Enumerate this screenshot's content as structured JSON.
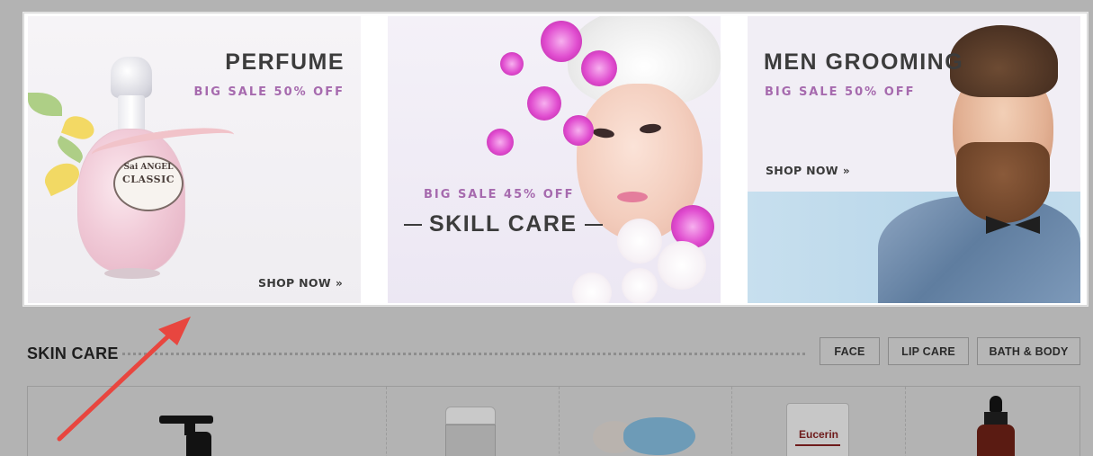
{
  "banners": [
    {
      "title": "PERFUME",
      "sale": "BIG SALE 50% OFF",
      "cta": "SHOP NOW",
      "bottle_brand": "Sai ANGEL",
      "bottle_label": "CLASSIC"
    },
    {
      "title": "SKILL CARE",
      "sale": "BIG SALE 45% OFF"
    },
    {
      "title": "MEN GROOMING",
      "sale": "BIG SALE 50% OFF",
      "cta": "SHOP NOW"
    }
  ],
  "section": {
    "title": "SKIN CARE",
    "tabs": [
      "FACE",
      "LIP CARE",
      "BATH & BODY"
    ]
  },
  "products": {
    "visible_brand": "Eucerin"
  },
  "colors": {
    "sale_accent": "#a66aae",
    "overlay": "#b3b3b3",
    "arrow": "#e8463f"
  },
  "icons": {
    "cta_chevron": "double-chevron-right-icon"
  }
}
